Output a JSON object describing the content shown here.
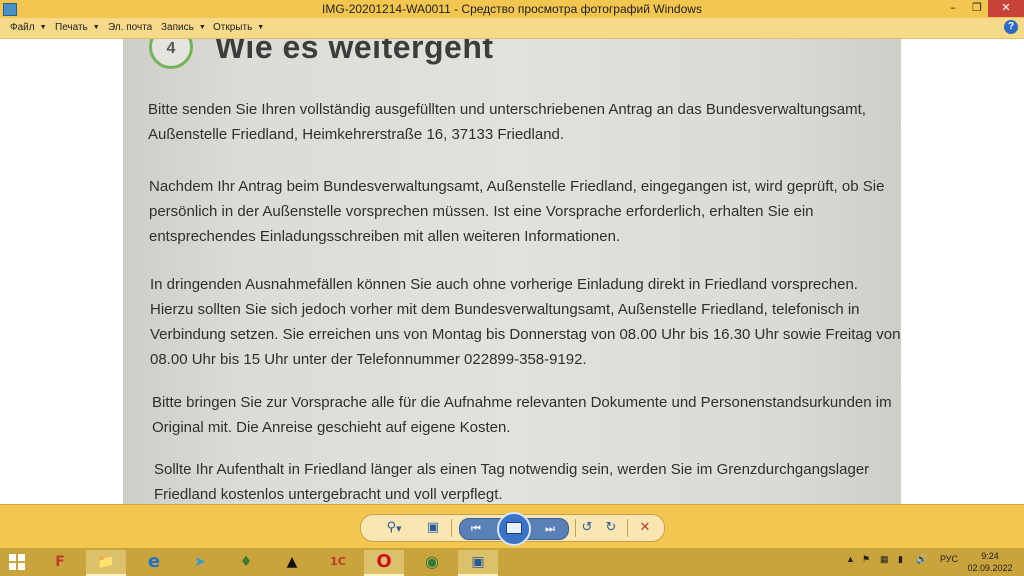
{
  "window": {
    "title": "IMG-20201214-WA0011 - Средство просмотра фотографий Windows"
  },
  "menu": {
    "items": [
      {
        "label": "Файл"
      },
      {
        "label": "Печать"
      },
      {
        "label": "Эл. почта"
      },
      {
        "label": "Запись"
      },
      {
        "label": "Открыть"
      }
    ],
    "help_icon": "help-icon"
  },
  "photo": {
    "step_number": "4",
    "heading": "Wie es weitergeht",
    "paragraphs": [
      {
        "lines": [
          "Bitte senden Sie Ihren vollständig ausgefüllten und unterschriebenen Antrag an das Bundesverwaltungsamt,",
          "Außenstelle Friedland, Heimkehrerstraße 16, 37133 Friedland."
        ]
      },
      {
        "lines": [
          "Nachdem Ihr Antrag beim Bundesverwaltungsamt, Außenstelle Friedland, eingegangen ist, wird geprüft, ob Sie",
          "persönlich in der Außenstelle vorsprechen müssen. Ist eine Vorsprache erforderlich, erhalten Sie ein",
          "entsprechendes Einladungsschreiben mit allen weiteren Informationen."
        ]
      },
      {
        "lines": [
          "In dringenden Ausnahmefällen können Sie auch ohne vorherige Einladung direkt in Friedland vorsprechen.",
          "Hierzu sollten Sie sich jedoch vorher mit dem Bundesverwaltungsamt, Außenstelle Friedland, telefonisch in",
          "Verbindung setzen. Sie erreichen uns von Montag bis Donnerstag von 08.00 Uhr bis 16.30 Uhr sowie Freitag von",
          "08.00 Uhr bis 15 Uhr unter der Telefonnummer 022899-358-9192."
        ]
      },
      {
        "lines": [
          "Bitte bringen Sie zur Vorsprache alle für die Aufnahme relevanten Dokumente und Personenstandsurkunden im",
          "Original mit. Die Anreise geschieht auf eigene Kosten."
        ]
      },
      {
        "lines": [
          "Sollte Ihr Aufenthalt in Friedland länger als einen Tag notwendig sein, werden Sie im Grenzdurchgangslager",
          "Friedland kostenlos untergebracht und voll verpflegt."
        ]
      }
    ]
  },
  "taskbar": {
    "tray_language": "РУС",
    "time": "9:24",
    "date": "02.09.2022"
  },
  "colors": {
    "chrome": "#f3c64f",
    "menubar": "#f7d98a",
    "taskbar": "#c9a43d",
    "close_button": "#c7433a",
    "accent_green": "#74b35b"
  }
}
